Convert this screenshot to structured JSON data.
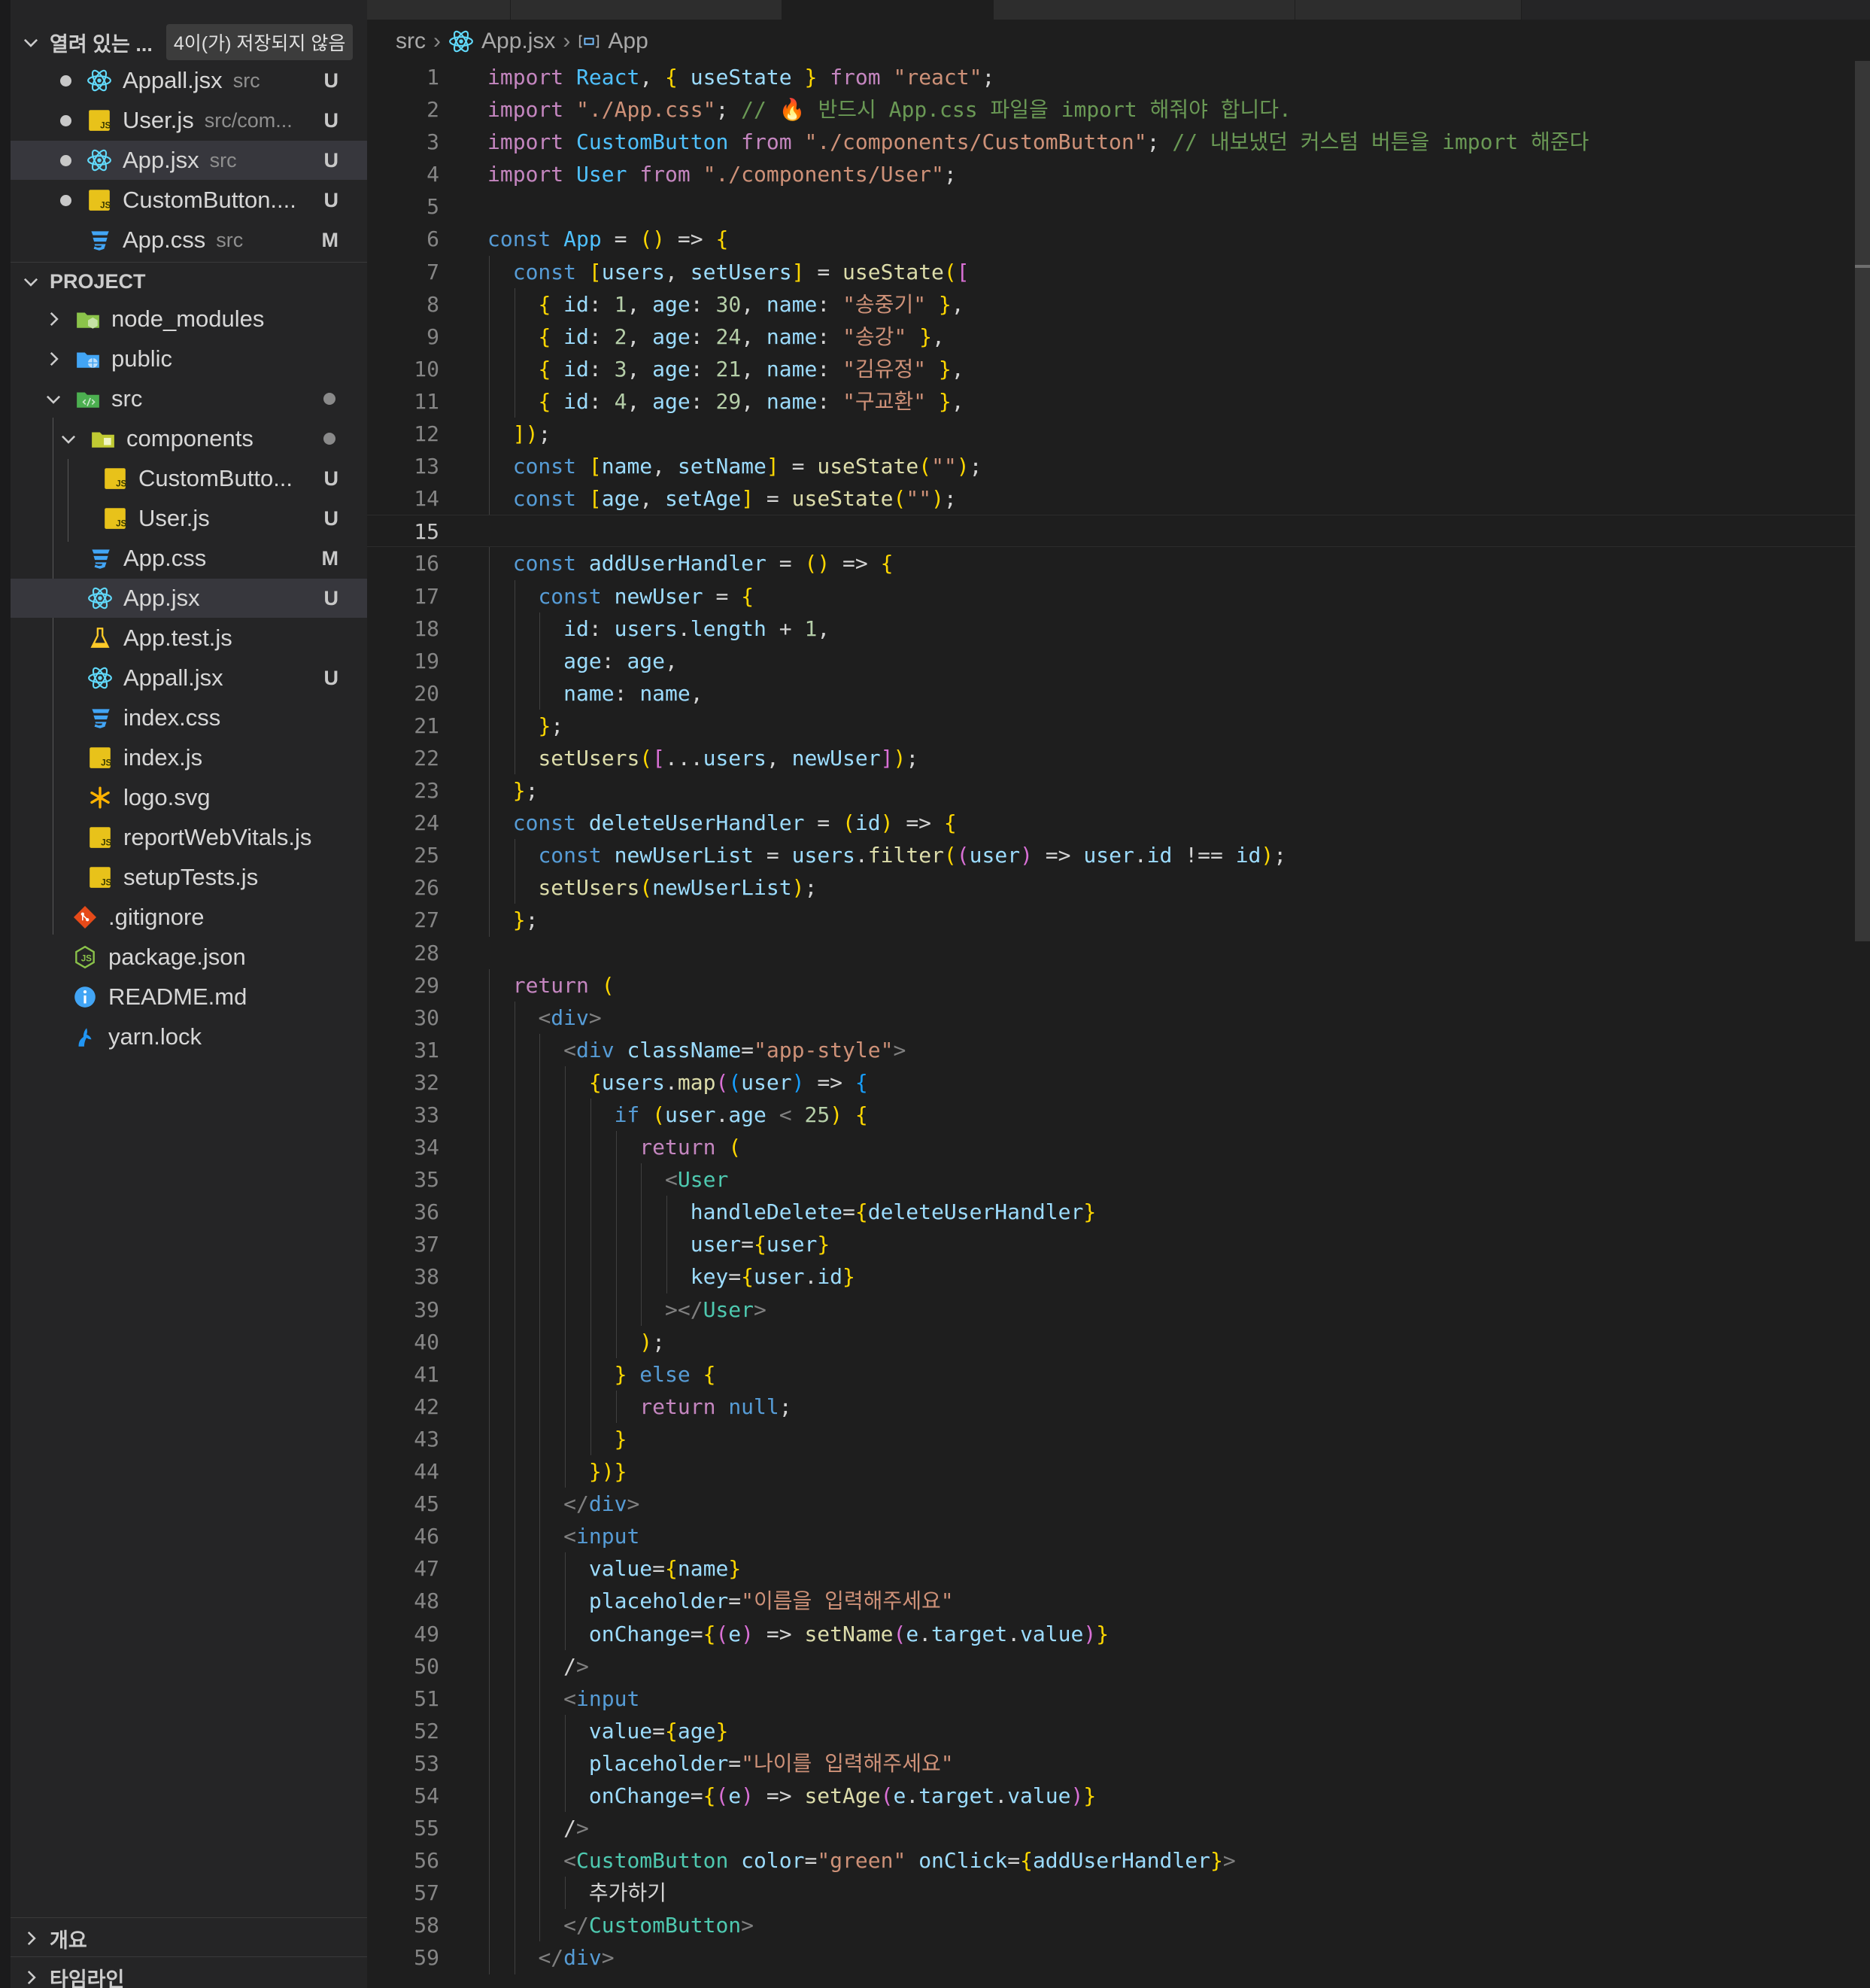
{
  "sidebar": {
    "open_editors": {
      "title": "열려 있는 ...",
      "unsaved_badge": "4이(가) 저장되지 않음",
      "items": [
        {
          "name": "Appall.jsx",
          "path": "src",
          "badge": "U",
          "icon": "react-icon"
        },
        {
          "name": "User.js",
          "path": "src/com...",
          "badge": "U",
          "icon": "js-icon"
        },
        {
          "name": "App.jsx",
          "path": "src",
          "badge": "U",
          "icon": "react-icon"
        },
        {
          "name": "CustomButton....",
          "path": "",
          "badge": "U",
          "icon": "js-icon"
        },
        {
          "name": "App.css",
          "path": "src",
          "badge": "M",
          "icon": "css-icon"
        }
      ]
    },
    "project": {
      "title": "PROJECT",
      "items": [
        {
          "name": "node_modules",
          "icon": "folder-node-icon"
        },
        {
          "name": "public",
          "icon": "folder-public-icon"
        },
        {
          "name": "src",
          "icon": "folder-src-icon"
        },
        {
          "name": "components",
          "icon": "folder-components-icon"
        },
        {
          "name": "CustomButto...",
          "badge": "U",
          "icon": "js-icon"
        },
        {
          "name": "User.js",
          "badge": "U",
          "icon": "js-icon"
        },
        {
          "name": "App.css",
          "badge": "M",
          "icon": "css-icon"
        },
        {
          "name": "App.jsx",
          "badge": "U",
          "icon": "react-icon"
        },
        {
          "name": "App.test.js",
          "icon": "test-flask-icon"
        },
        {
          "name": "Appall.jsx",
          "badge": "U",
          "icon": "react-icon"
        },
        {
          "name": "index.css",
          "icon": "css-icon"
        },
        {
          "name": "index.js",
          "icon": "js-icon"
        },
        {
          "name": "logo.svg",
          "icon": "svg-asterisk-icon"
        },
        {
          "name": "reportWebVitals.js",
          "icon": "js-icon"
        },
        {
          "name": "setupTests.js",
          "icon": "js-icon"
        },
        {
          "name": ".gitignore",
          "icon": "git-icon"
        },
        {
          "name": "package.json",
          "icon": "nodejs-icon"
        },
        {
          "name": "README.md",
          "icon": "info-icon"
        },
        {
          "name": "yarn.lock",
          "icon": "yarn-icon"
        }
      ]
    },
    "outline_title": "개요",
    "timeline_title": "타임라인"
  },
  "breadcrumb": {
    "folder": "src",
    "file": "App.jsx",
    "symbol": "App"
  },
  "editor": {
    "current_line": 15,
    "lines": [
      "import React, { useState } from \"react\";",
      "import \"./App.css\"; // 🔥 반드시 App.css 파일을 import 해줘야 합니다.",
      "import CustomButton from \"./components/CustomButton\"; // 내보냈던 커스텀 버튼을 import 해준다",
      "import User from \"./components/User\";",
      "",
      "const App = () => {",
      "  const [users, setUsers] = useState([",
      "    { id: 1, age: 30, name: \"송중기\" },",
      "    { id: 2, age: 24, name: \"송강\" },",
      "    { id: 3, age: 21, name: \"김유정\" },",
      "    { id: 4, age: 29, name: \"구교환\" },",
      "  ]);",
      "  const [name, setName] = useState(\"\");",
      "  const [age, setAge] = useState(\"\");",
      "",
      "  const addUserHandler = () => {",
      "    const newUser = {",
      "      id: users.length + 1,",
      "      age: age,",
      "      name: name,",
      "    };",
      "    setUsers([...users, newUser]);",
      "  };",
      "  const deleteUserHandler = (id) => {",
      "    const newUserList = users.filter((user) => user.id !== id);",
      "    setUsers(newUserList);",
      "  };",
      "",
      "  return (",
      "    <div>",
      "      <div className=\"app-style\">",
      "        {users.map((user) => {",
      "          if (user.age < 25) {",
      "            return (",
      "              <User",
      "                handleDelete={deleteUserHandler}",
      "                user={user}",
      "                key={user.id}",
      "              ></User>",
      "            );",
      "          } else {",
      "            return null;",
      "          }",
      "        })}",
      "      </div>",
      "      <input",
      "        value={name}",
      "        placeholder=\"이름을 입력해주세요\"",
      "        onChange={(e) => setName(e.target.value)}",
      "      />",
      "      <input",
      "        value={age}",
      "        placeholder=\"나이를 입력해주세요\"",
      "        onChange={(e) => setAge(e.target.value)}",
      "      />",
      "      <CustomButton color=\"green\" onClick={addUserHandler}>",
      "        추가하기",
      "      </CustomButton>",
      "    </div>"
    ]
  }
}
